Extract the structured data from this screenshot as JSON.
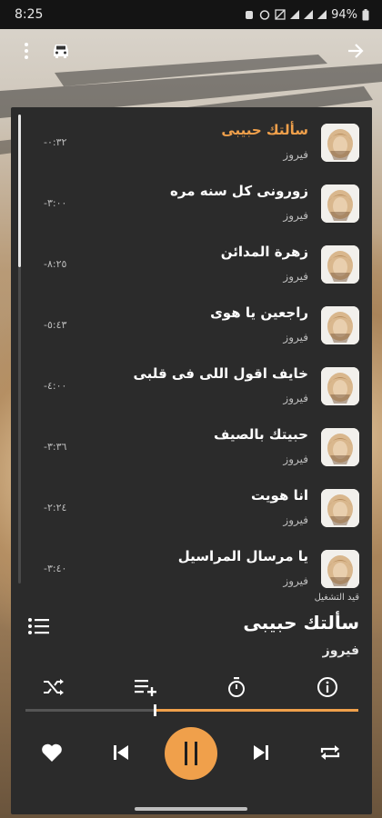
{
  "status_bar": {
    "time": "8:25",
    "battery": "94%"
  },
  "songs": [
    {
      "title": "سألتك حبيبى",
      "artist": "فيروز",
      "duration": "-٠:٣٢",
      "active": true
    },
    {
      "title": "زورونى كل سنه مره",
      "artist": "فيروز",
      "duration": "-٣:٠٠",
      "active": false
    },
    {
      "title": "زهرة المدائن",
      "artist": "فيروز",
      "duration": "-٨:٢٥",
      "active": false
    },
    {
      "title": "راجعين يا هوى",
      "artist": "فيروز",
      "duration": "-٥:٤٣",
      "active": false
    },
    {
      "title": "خايف اقول اللى فى قلبى",
      "artist": "فيروز",
      "duration": "-٤:٠٠",
      "active": false
    },
    {
      "title": "حبيتك بالصيف",
      "artist": "فيروز",
      "duration": "-٣:٣٦",
      "active": false
    },
    {
      "title": "انا هويت",
      "artist": "فيروز",
      "duration": "-٢:٢٤",
      "active": false
    },
    {
      "title": "يا مرسال المراسيل",
      "artist": "فيروز",
      "duration": "-٣:٤٠",
      "active": false
    }
  ],
  "now_playing": {
    "label": "قيد التشغيل",
    "title": "سألتك حبيبى",
    "artist": "فيروز",
    "progress": 0.39
  },
  "colors": {
    "accent": "#f0a04b",
    "panel": "#2b2b2b"
  },
  "icons": {
    "toolbar": [
      "more-vert-icon",
      "car-icon",
      "arrow-forward-icon"
    ],
    "actions": [
      "shuffle-icon",
      "playlist-add-icon",
      "timer-icon",
      "info-icon"
    ],
    "controls": [
      "heart-icon",
      "skip-previous-icon",
      "pause-icon",
      "skip-next-icon",
      "repeat-icon"
    ]
  }
}
